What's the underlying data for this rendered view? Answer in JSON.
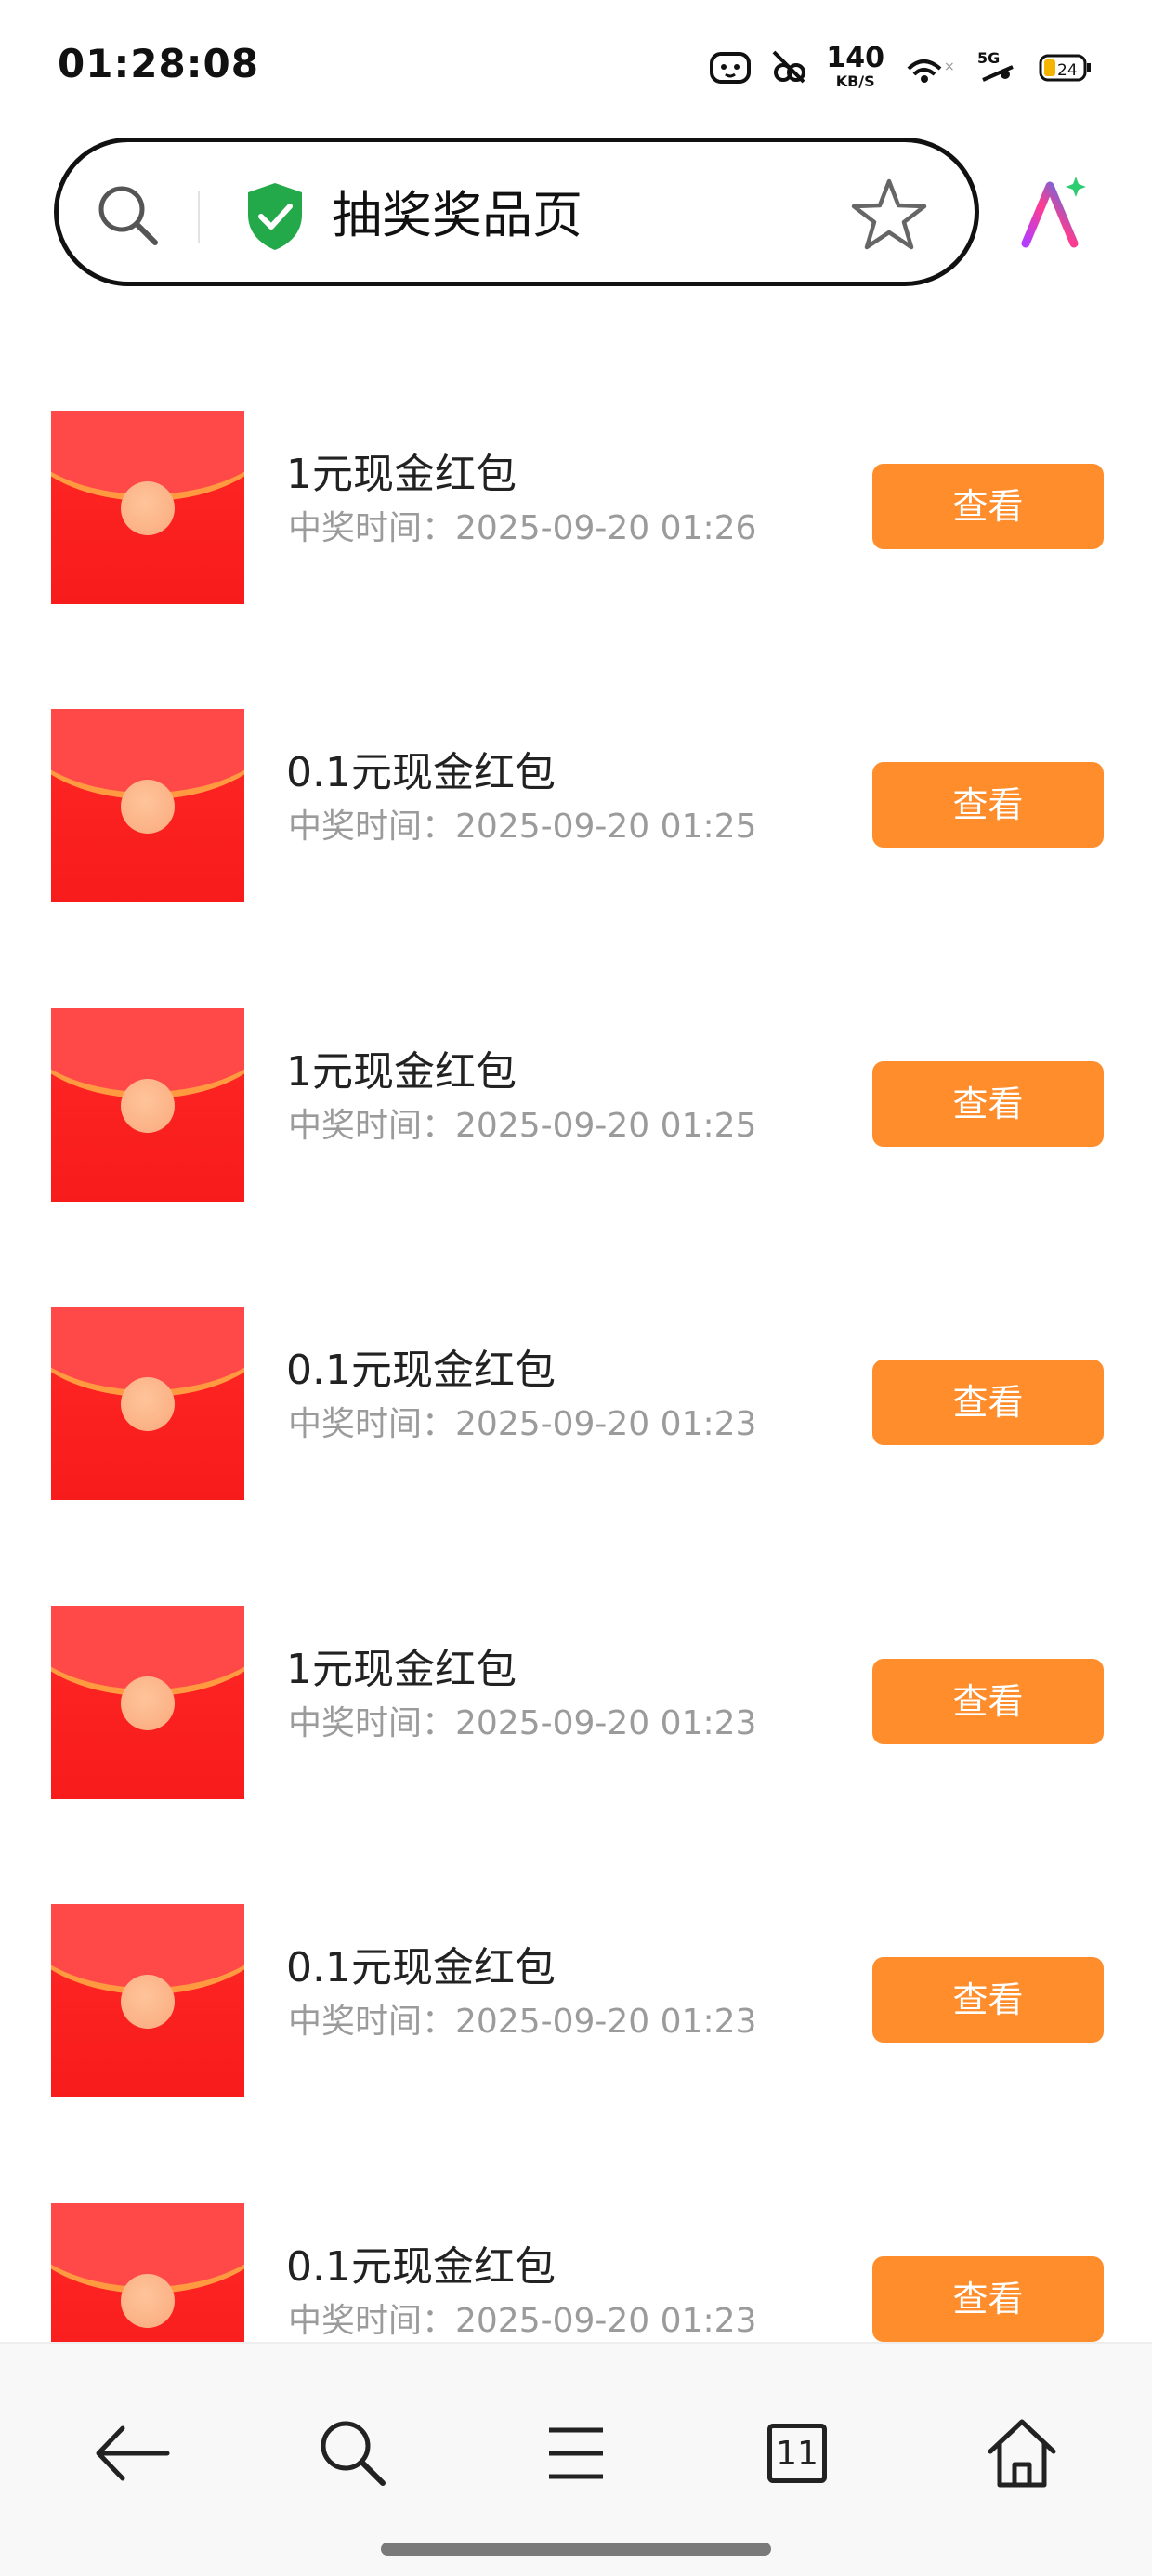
{
  "status_bar": {
    "time": "01:28:08",
    "net_speed_value": "140",
    "net_speed_unit": "KB/S",
    "signal": "5G",
    "battery": "24"
  },
  "address_bar": {
    "title": "抽奖奖品页"
  },
  "prizes": [
    {
      "name": "1元现金红包",
      "time": "中奖时间：2025-09-20 01:26",
      "button": "查看"
    },
    {
      "name": "0.1元现金红包",
      "time": "中奖时间：2025-09-20 01:25",
      "button": "查看"
    },
    {
      "name": "1元现金红包",
      "time": "中奖时间：2025-09-20 01:25",
      "button": "查看"
    },
    {
      "name": "0.1元现金红包",
      "time": "中奖时间：2025-09-20 01:23",
      "button": "查看"
    },
    {
      "name": "1元现金红包",
      "time": "中奖时间：2025-09-20 01:23",
      "button": "查看"
    },
    {
      "name": "0.1元现金红包",
      "time": "中奖时间：2025-09-20 01:23",
      "button": "查看"
    },
    {
      "name": "0.1元现金红包",
      "time": "中奖时间：2025-09-20 01:23",
      "button": "查看"
    }
  ],
  "bottom_nav": {
    "tab_count": "11"
  },
  "colors": {
    "accent_button": "#ff8d2c",
    "envelope_red": "#ff2828",
    "shield_green": "#23a94a"
  },
  "icons": {
    "address_bar": [
      "search-icon",
      "shield-check-icon",
      "star-icon"
    ],
    "ai": "ai-assistant-icon",
    "bottom_nav": [
      "back-arrow-icon",
      "search-icon",
      "menu-icon",
      "tabs-icon",
      "home-icon"
    ]
  }
}
